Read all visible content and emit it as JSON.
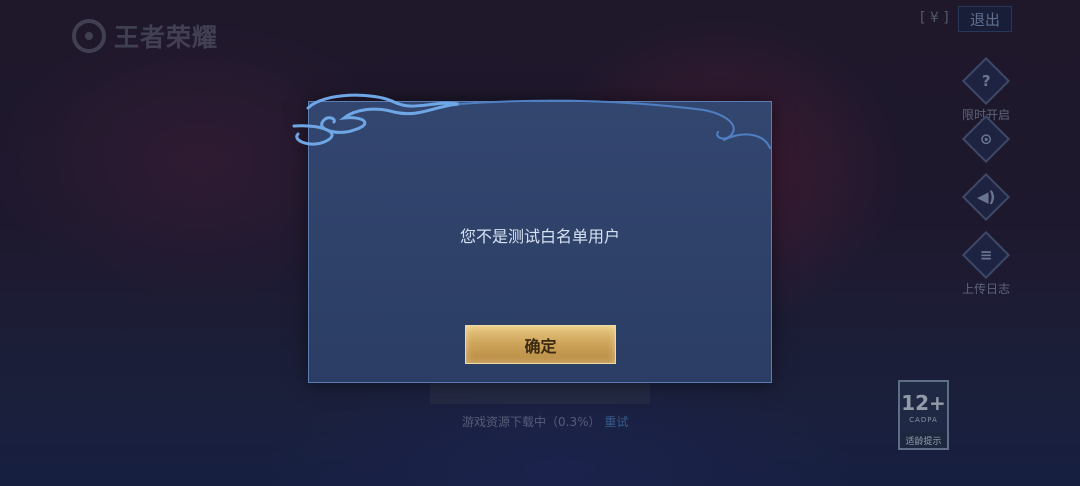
{
  "app": {
    "logo_text": "王者荣耀",
    "currency_symbol": "[ ¥ ]",
    "exit_label": "退出"
  },
  "side_menu": {
    "items": [
      {
        "icon": "question-icon",
        "glyph": "?",
        "label": "限时开启"
      },
      {
        "icon": "gamepad-icon",
        "glyph": "⊙",
        "label": ""
      },
      {
        "icon": "speaker-icon",
        "glyph": "◀)",
        "label": ""
      },
      {
        "icon": "log-icon",
        "glyph": "≡",
        "label": "上传日志"
      }
    ]
  },
  "download": {
    "status_text": "游戏资源下载中（0.3%）",
    "retry_label": "重试"
  },
  "age_rating": {
    "number": "12+",
    "org": "CADPA",
    "label": "适龄提示"
  },
  "dialog": {
    "message": "您不是测试白名单用户",
    "confirm_label": "确定"
  },
  "colors": {
    "dialog_bg": "#2e4169",
    "button_gold": "#cfa55c",
    "accent_blue": "#4d86c8"
  }
}
